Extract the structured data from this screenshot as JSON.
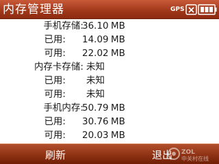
{
  "titlebar": {
    "title": "内存管理器",
    "gps": "GPS"
  },
  "status_icons": [
    "connectivity-icon",
    "battery-icon"
  ],
  "memory": {
    "sections": [
      {
        "label": "手机存储:",
        "rows": [
          {
            "label": "已用:",
            "value": "14.09",
            "unit": "MB"
          },
          {
            "label": "可用:",
            "value": "22.02",
            "unit": "MB"
          }
        ],
        "value": "36.10",
        "unit": "MB"
      },
      {
        "label": "内存卡存储:",
        "value": "未知",
        "unit": "",
        "rows": [
          {
            "label": "已用:",
            "value": "未知",
            "unit": ""
          },
          {
            "label": "可用:",
            "value": "未知",
            "unit": ""
          }
        ]
      },
      {
        "label": "手机内存:",
        "value": "50.79",
        "unit": "MB",
        "rows": [
          {
            "label": "已用:",
            "value": "30.76",
            "unit": "MB"
          },
          {
            "label": "可用:",
            "value": "20.03",
            "unit": "MB"
          }
        ]
      }
    ]
  },
  "softkeys": {
    "left": "刷新",
    "right": "退出"
  },
  "watermark": {
    "brand": "ZOL",
    "text": "中关村在线"
  },
  "colors": {
    "bar": "#a23a1c",
    "bar_text": "#ffffff",
    "body_text": "#1a1a1a"
  }
}
